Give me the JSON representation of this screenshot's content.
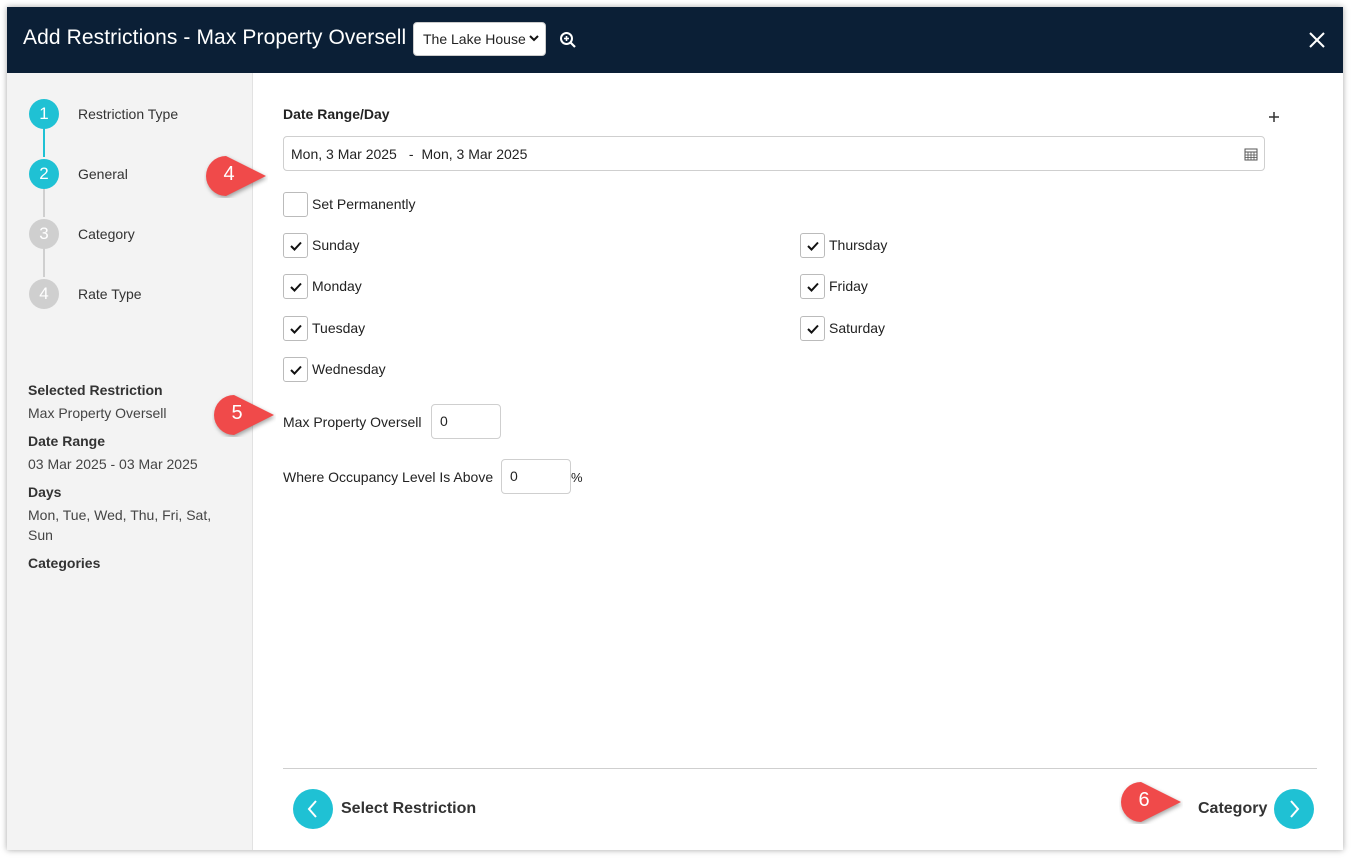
{
  "header": {
    "title": "Add Restrictions - Max Property Oversell",
    "property_select": "The Lake House"
  },
  "steps": [
    {
      "num": "1",
      "label": "Restriction Type",
      "state": "active"
    },
    {
      "num": "2",
      "label": "General",
      "state": "active"
    },
    {
      "num": "3",
      "label": "Category",
      "state": "inactive"
    },
    {
      "num": "4",
      "label": "Rate Type",
      "state": "inactive"
    }
  ],
  "summary": {
    "selected_restriction_heading": "Selected Restriction",
    "selected_restriction_value": "Max Property Oversell",
    "date_range_heading": "Date Range",
    "date_range_value": "03 Mar 2025 - 03 Mar 2025",
    "days_heading": "Days",
    "days_value": "Mon, Tue, Wed, Thu, Fri, Sat, Sun",
    "categories_heading": "Categories"
  },
  "form": {
    "section_title": "Date Range/Day",
    "date_start": "Mon, 3 Mar 2025",
    "date_sep": "-",
    "date_end": "Mon, 3 Mar 2025",
    "set_permanently": {
      "label": "Set Permanently",
      "checked": false
    },
    "days": [
      {
        "label": "Sunday",
        "checked": true
      },
      {
        "label": "Monday",
        "checked": true
      },
      {
        "label": "Tuesday",
        "checked": true
      },
      {
        "label": "Wednesday",
        "checked": true
      },
      {
        "label": "Thursday",
        "checked": true
      },
      {
        "label": "Friday",
        "checked": true
      },
      {
        "label": "Saturday",
        "checked": true
      }
    ],
    "max_oversell_label": "Max Property Oversell",
    "max_oversell_value": "0",
    "occupancy_label": "Where Occupancy Level Is Above",
    "occupancy_value": "0",
    "occupancy_unit": "%"
  },
  "footer": {
    "back_label": "Select Restriction",
    "next_label": "Category"
  },
  "callouts": {
    "c4": "4",
    "c5": "5",
    "c6": "6"
  },
  "colors": {
    "header_bg": "#0b1f36",
    "accent": "#1fc1d4",
    "callout": "#f04a4a",
    "sidebar_bg": "#f3f3f3"
  }
}
